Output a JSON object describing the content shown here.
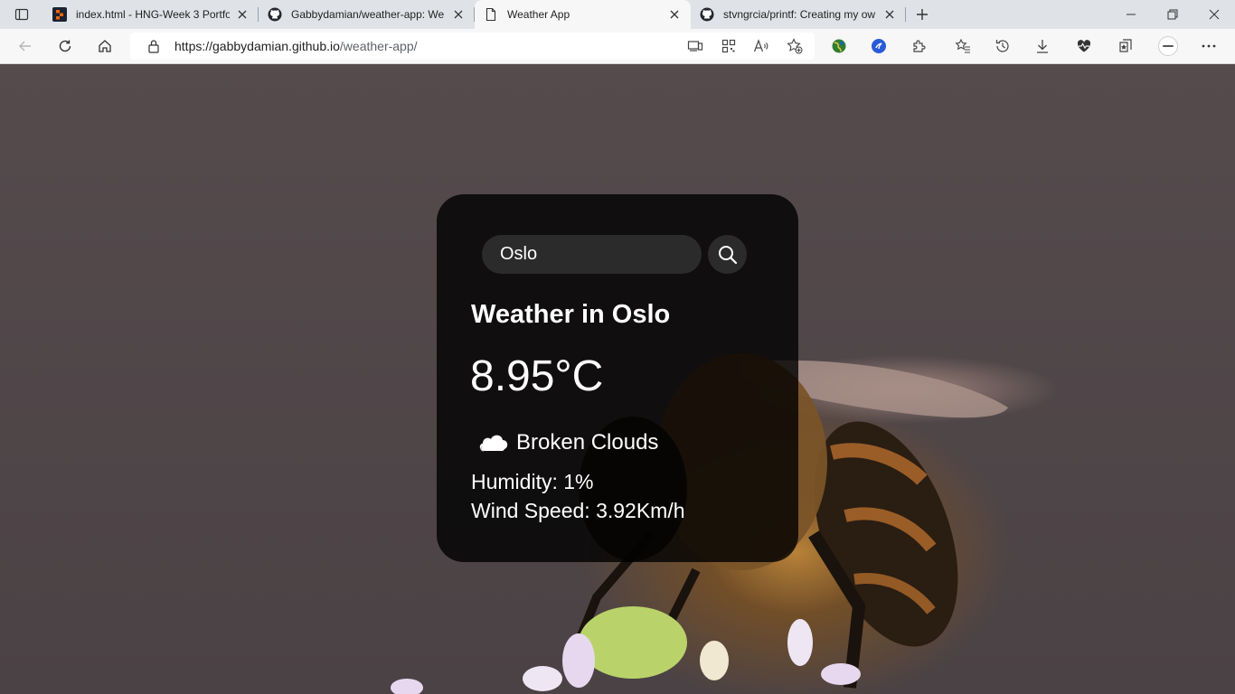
{
  "browser": {
    "tabs": [
      {
        "title": "index.html - HNG-Week 3 Portfo",
        "favicon": "replit-icon",
        "active": false
      },
      {
        "title": "Gabbydamian/weather-app: We",
        "favicon": "github-icon",
        "active": false
      },
      {
        "title": "Weather App",
        "favicon": "page-icon",
        "active": true
      },
      {
        "title": "stvngrcia/printf: Creating my ow",
        "favicon": "github-icon",
        "active": false
      }
    ],
    "address": {
      "host": "https://gabbydamian.github.io",
      "path": "/weather-app/"
    }
  },
  "weather": {
    "search": {
      "value": "Oslo",
      "placeholder": ""
    },
    "city_title": "Weather in Oslo",
    "temperature": "8.95°C",
    "description": "Broken Clouds",
    "icon": "cloud-icon",
    "humidity": "Humidity: 1%",
    "wind": "Wind Speed: 3.92Km/h"
  },
  "colors": {
    "card_bg": "#000000cc",
    "page_bg": "#514749",
    "text": "#ffffff"
  }
}
